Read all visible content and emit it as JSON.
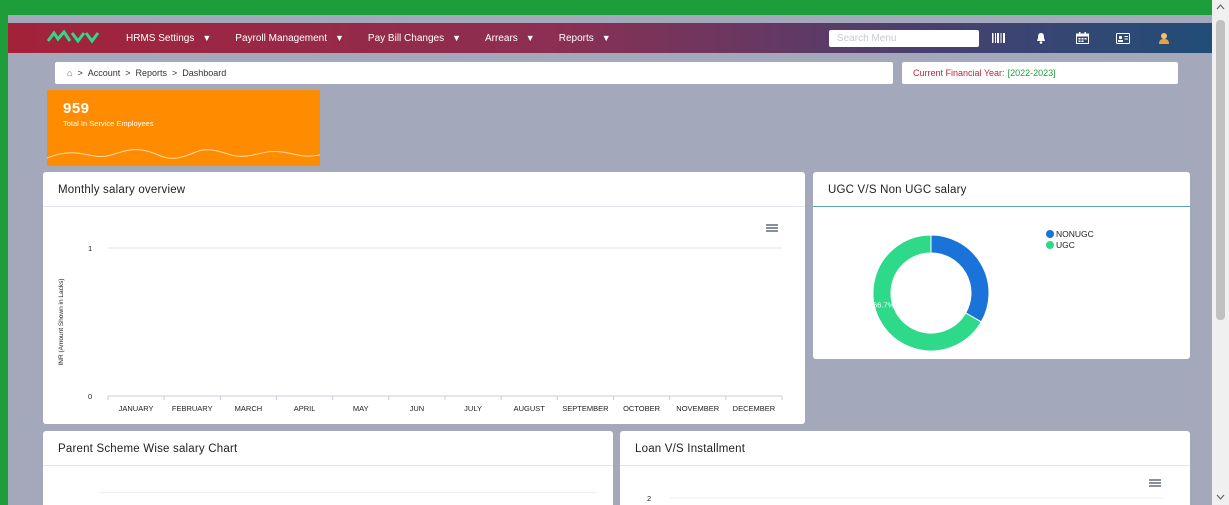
{
  "nav": {
    "items": [
      {
        "label": "HRMS Settings"
      },
      {
        "label": "Payroll Management"
      },
      {
        "label": "Pay Bill Changes"
      },
      {
        "label": "Arrears"
      },
      {
        "label": "Reports"
      }
    ],
    "search_placeholder": "Search Menu",
    "icons": [
      "barcode-icon",
      "bell-icon",
      "calendar-icon",
      "id-card-icon",
      "user-avatar-icon"
    ]
  },
  "breadcrumb": {
    "home_icon": "home-icon",
    "separator": ">",
    "items": [
      "Account",
      "Reports",
      "Dashboard"
    ]
  },
  "financial_year": {
    "label": "Current Financial Year:",
    "value": "[2022-2023]"
  },
  "stat_card": {
    "value": "959",
    "label": "Total In Service Employees",
    "color": "#ff8c00"
  },
  "monthly_salary": {
    "title": "Monthly salary overview"
  },
  "ugc_salary": {
    "title": "UGC V/S Non UGC salary"
  },
  "parent_scheme": {
    "title": "Parent Scheme Wise salary Chart"
  },
  "loan": {
    "title": "Loan V/S Installment"
  },
  "chart_data": [
    {
      "type": "line",
      "title": "Monthly salary overview",
      "xlabel": "",
      "ylabel": "INR (Amount Shown in Lacks)",
      "categories": [
        "JANUARY",
        "FEBRUARY",
        "MARCH",
        "APRIL",
        "MAY",
        "JUN",
        "JULY",
        "AUGUST",
        "SEPTEMBER",
        "OCTOBER",
        "NOVEMBER",
        "DECEMBER"
      ],
      "yticks": [
        "0",
        "1"
      ],
      "ylim": [
        0,
        1
      ],
      "series": [],
      "grid": true
    },
    {
      "type": "pie",
      "title": "UGC V/S Non UGC salary",
      "labels": [
        "NONUGC",
        "UGC"
      ],
      "values": [
        33.3,
        66.7
      ],
      "data_labels": [
        "33.3%",
        "66.7%"
      ],
      "colors": [
        "#1a73d9",
        "#2ed98a"
      ],
      "legend": "top-right"
    },
    {
      "type": "bar",
      "title": "Loan V/S Installment",
      "yticks": [
        "2"
      ],
      "series": []
    }
  ]
}
